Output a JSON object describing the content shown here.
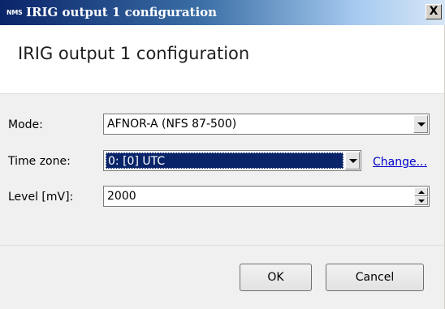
{
  "window": {
    "app_icon_text": "NMS",
    "title": "IRIG output 1 configuration",
    "close_glyph": "X"
  },
  "header": {
    "title": "IRIG output 1 configuration"
  },
  "form": {
    "mode": {
      "label": "Mode:",
      "value": "AFNOR-A (NFS 87-500)"
    },
    "time_zone": {
      "label": "Time zone:",
      "value": "0: [0] UTC",
      "change_link": "Change..."
    },
    "level": {
      "label": "Level [mV]:",
      "value": "2000"
    }
  },
  "buttons": {
    "ok": "OK",
    "cancel": "Cancel"
  },
  "colors": {
    "title_bar_start": "#0a246a",
    "title_bar_end": "#d8e6f5",
    "selection": "#0a246a",
    "link": "#0000cc"
  }
}
